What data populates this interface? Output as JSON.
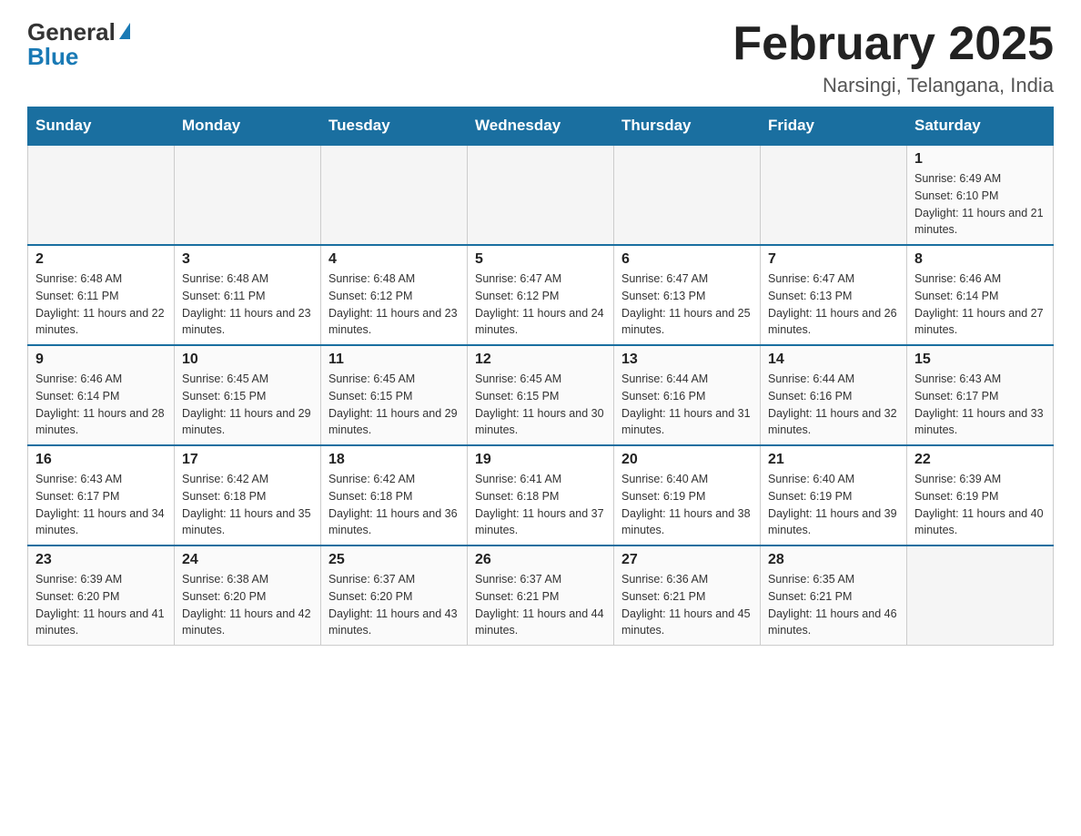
{
  "logo": {
    "general_text": "General",
    "blue_text": "Blue"
  },
  "header": {
    "month_title": "February 2025",
    "location": "Narsingi, Telangana, India"
  },
  "days_of_week": [
    "Sunday",
    "Monday",
    "Tuesday",
    "Wednesday",
    "Thursday",
    "Friday",
    "Saturday"
  ],
  "weeks": [
    [
      {
        "day": "",
        "sunrise": "",
        "sunset": "",
        "daylight": "",
        "empty": true
      },
      {
        "day": "",
        "sunrise": "",
        "sunset": "",
        "daylight": "",
        "empty": true
      },
      {
        "day": "",
        "sunrise": "",
        "sunset": "",
        "daylight": "",
        "empty": true
      },
      {
        "day": "",
        "sunrise": "",
        "sunset": "",
        "daylight": "",
        "empty": true
      },
      {
        "day": "",
        "sunrise": "",
        "sunset": "",
        "daylight": "",
        "empty": true
      },
      {
        "day": "",
        "sunrise": "",
        "sunset": "",
        "daylight": "",
        "empty": true
      },
      {
        "day": "1",
        "sunrise": "Sunrise: 6:49 AM",
        "sunset": "Sunset: 6:10 PM",
        "daylight": "Daylight: 11 hours and 21 minutes.",
        "empty": false
      }
    ],
    [
      {
        "day": "2",
        "sunrise": "Sunrise: 6:48 AM",
        "sunset": "Sunset: 6:11 PM",
        "daylight": "Daylight: 11 hours and 22 minutes.",
        "empty": false
      },
      {
        "day": "3",
        "sunrise": "Sunrise: 6:48 AM",
        "sunset": "Sunset: 6:11 PM",
        "daylight": "Daylight: 11 hours and 23 minutes.",
        "empty": false
      },
      {
        "day": "4",
        "sunrise": "Sunrise: 6:48 AM",
        "sunset": "Sunset: 6:12 PM",
        "daylight": "Daylight: 11 hours and 23 minutes.",
        "empty": false
      },
      {
        "day": "5",
        "sunrise": "Sunrise: 6:47 AM",
        "sunset": "Sunset: 6:12 PM",
        "daylight": "Daylight: 11 hours and 24 minutes.",
        "empty": false
      },
      {
        "day": "6",
        "sunrise": "Sunrise: 6:47 AM",
        "sunset": "Sunset: 6:13 PM",
        "daylight": "Daylight: 11 hours and 25 minutes.",
        "empty": false
      },
      {
        "day": "7",
        "sunrise": "Sunrise: 6:47 AM",
        "sunset": "Sunset: 6:13 PM",
        "daylight": "Daylight: 11 hours and 26 minutes.",
        "empty": false
      },
      {
        "day": "8",
        "sunrise": "Sunrise: 6:46 AM",
        "sunset": "Sunset: 6:14 PM",
        "daylight": "Daylight: 11 hours and 27 minutes.",
        "empty": false
      }
    ],
    [
      {
        "day": "9",
        "sunrise": "Sunrise: 6:46 AM",
        "sunset": "Sunset: 6:14 PM",
        "daylight": "Daylight: 11 hours and 28 minutes.",
        "empty": false
      },
      {
        "day": "10",
        "sunrise": "Sunrise: 6:45 AM",
        "sunset": "Sunset: 6:15 PM",
        "daylight": "Daylight: 11 hours and 29 minutes.",
        "empty": false
      },
      {
        "day": "11",
        "sunrise": "Sunrise: 6:45 AM",
        "sunset": "Sunset: 6:15 PM",
        "daylight": "Daylight: 11 hours and 29 minutes.",
        "empty": false
      },
      {
        "day": "12",
        "sunrise": "Sunrise: 6:45 AM",
        "sunset": "Sunset: 6:15 PM",
        "daylight": "Daylight: 11 hours and 30 minutes.",
        "empty": false
      },
      {
        "day": "13",
        "sunrise": "Sunrise: 6:44 AM",
        "sunset": "Sunset: 6:16 PM",
        "daylight": "Daylight: 11 hours and 31 minutes.",
        "empty": false
      },
      {
        "day": "14",
        "sunrise": "Sunrise: 6:44 AM",
        "sunset": "Sunset: 6:16 PM",
        "daylight": "Daylight: 11 hours and 32 minutes.",
        "empty": false
      },
      {
        "day": "15",
        "sunrise": "Sunrise: 6:43 AM",
        "sunset": "Sunset: 6:17 PM",
        "daylight": "Daylight: 11 hours and 33 minutes.",
        "empty": false
      }
    ],
    [
      {
        "day": "16",
        "sunrise": "Sunrise: 6:43 AM",
        "sunset": "Sunset: 6:17 PM",
        "daylight": "Daylight: 11 hours and 34 minutes.",
        "empty": false
      },
      {
        "day": "17",
        "sunrise": "Sunrise: 6:42 AM",
        "sunset": "Sunset: 6:18 PM",
        "daylight": "Daylight: 11 hours and 35 minutes.",
        "empty": false
      },
      {
        "day": "18",
        "sunrise": "Sunrise: 6:42 AM",
        "sunset": "Sunset: 6:18 PM",
        "daylight": "Daylight: 11 hours and 36 minutes.",
        "empty": false
      },
      {
        "day": "19",
        "sunrise": "Sunrise: 6:41 AM",
        "sunset": "Sunset: 6:18 PM",
        "daylight": "Daylight: 11 hours and 37 minutes.",
        "empty": false
      },
      {
        "day": "20",
        "sunrise": "Sunrise: 6:40 AM",
        "sunset": "Sunset: 6:19 PM",
        "daylight": "Daylight: 11 hours and 38 minutes.",
        "empty": false
      },
      {
        "day": "21",
        "sunrise": "Sunrise: 6:40 AM",
        "sunset": "Sunset: 6:19 PM",
        "daylight": "Daylight: 11 hours and 39 minutes.",
        "empty": false
      },
      {
        "day": "22",
        "sunrise": "Sunrise: 6:39 AM",
        "sunset": "Sunset: 6:19 PM",
        "daylight": "Daylight: 11 hours and 40 minutes.",
        "empty": false
      }
    ],
    [
      {
        "day": "23",
        "sunrise": "Sunrise: 6:39 AM",
        "sunset": "Sunset: 6:20 PM",
        "daylight": "Daylight: 11 hours and 41 minutes.",
        "empty": false
      },
      {
        "day": "24",
        "sunrise": "Sunrise: 6:38 AM",
        "sunset": "Sunset: 6:20 PM",
        "daylight": "Daylight: 11 hours and 42 minutes.",
        "empty": false
      },
      {
        "day": "25",
        "sunrise": "Sunrise: 6:37 AM",
        "sunset": "Sunset: 6:20 PM",
        "daylight": "Daylight: 11 hours and 43 minutes.",
        "empty": false
      },
      {
        "day": "26",
        "sunrise": "Sunrise: 6:37 AM",
        "sunset": "Sunset: 6:21 PM",
        "daylight": "Daylight: 11 hours and 44 minutes.",
        "empty": false
      },
      {
        "day": "27",
        "sunrise": "Sunrise: 6:36 AM",
        "sunset": "Sunset: 6:21 PM",
        "daylight": "Daylight: 11 hours and 45 minutes.",
        "empty": false
      },
      {
        "day": "28",
        "sunrise": "Sunrise: 6:35 AM",
        "sunset": "Sunset: 6:21 PM",
        "daylight": "Daylight: 11 hours and 46 minutes.",
        "empty": false
      },
      {
        "day": "",
        "sunrise": "",
        "sunset": "",
        "daylight": "",
        "empty": true
      }
    ]
  ]
}
